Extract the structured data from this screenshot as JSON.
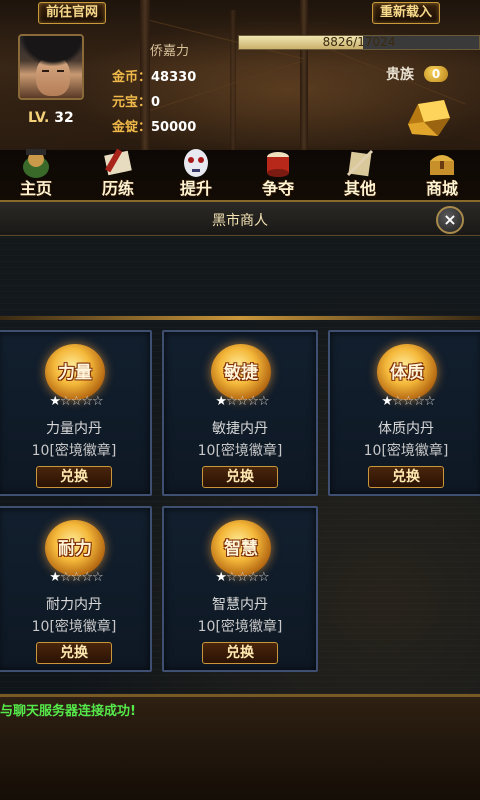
{
  "header": {
    "official_site_button": "前往官网",
    "reload_button": "重新载入",
    "player_name": "侨嘉力",
    "level_label": "LV.",
    "level": "32",
    "exp_text": "8826/17024",
    "exp_progress": 0.518,
    "gold_label": "金币：",
    "gold_value": "48330",
    "yuanbao_label": "元宝：",
    "yuanbao_value": "0",
    "ingot_label": "金锭：",
    "ingot_value": "50000",
    "noble_label": "贵族",
    "noble_level": "0"
  },
  "nav": {
    "items": [
      {
        "label": "主页",
        "icon": "general-icon"
      },
      {
        "label": "历练",
        "icon": "scroll-icon"
      },
      {
        "label": "提升",
        "icon": "mask-icon"
      },
      {
        "label": "争夺",
        "icon": "drum-icon"
      },
      {
        "label": "其他",
        "icon": "sword-icon"
      },
      {
        "label": "商城",
        "icon": "chest-icon"
      }
    ]
  },
  "panel": {
    "title": "黑市商人",
    "close_icon": "×"
  },
  "shop": {
    "redeem_label": "兑换",
    "items": [
      {
        "badge": "力量",
        "name": "力量内丹",
        "cost": "10[密境徽章]",
        "stars": 1,
        "stars_max": 5
      },
      {
        "badge": "敏捷",
        "name": "敏捷内丹",
        "cost": "10[密境徽章]",
        "stars": 1,
        "stars_max": 5
      },
      {
        "badge": "体质",
        "name": "体质内丹",
        "cost": "10[密境徽章]",
        "stars": 1,
        "stars_max": 5
      },
      {
        "badge": "耐力",
        "name": "耐力内丹",
        "cost": "10[密境徽章]",
        "stars": 1,
        "stars_max": 5
      },
      {
        "badge": "智慧",
        "name": "智慧内丹",
        "cost": "10[密境徽章]",
        "stars": 1,
        "stars_max": 5
      }
    ]
  },
  "chat": {
    "message": "与聊天服务器连接成功!"
  },
  "colors": {
    "accent_gold": "#c9963a",
    "chat_green": "#55e84a",
    "card_border": "#3f4f72"
  }
}
